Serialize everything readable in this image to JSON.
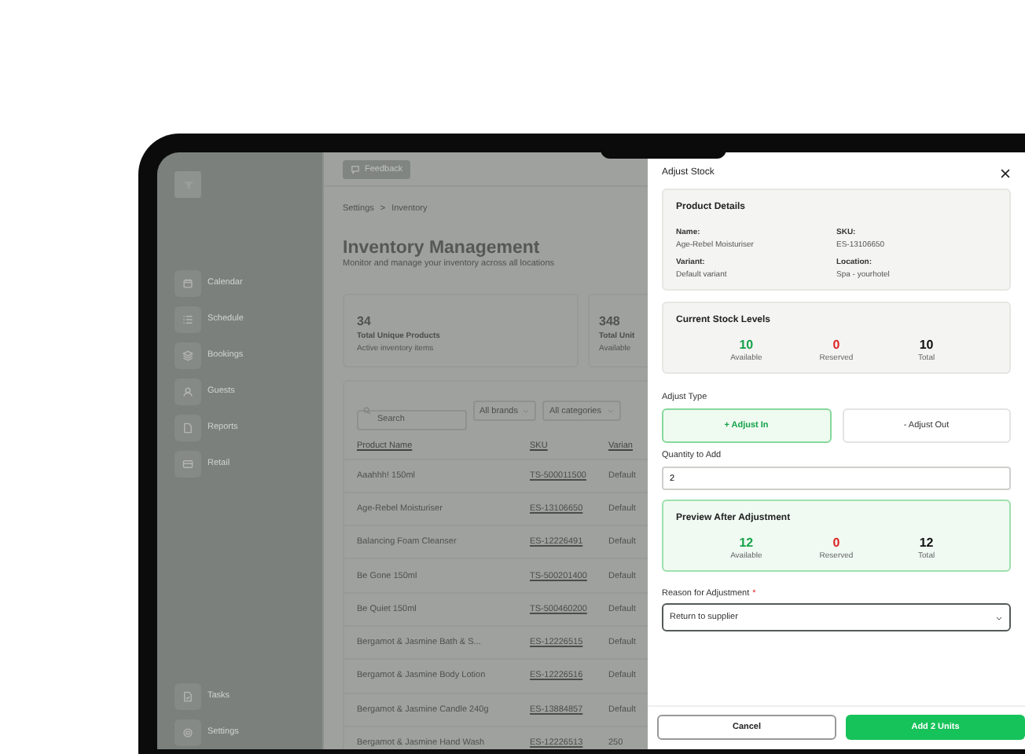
{
  "sidebar": {
    "items": [
      {
        "label": "Calendar"
      },
      {
        "label": "Schedule"
      },
      {
        "label": "Bookings"
      },
      {
        "label": "Guests"
      },
      {
        "label": "Reports"
      },
      {
        "label": "Retail"
      }
    ],
    "bottom_items": [
      {
        "label": "Tasks"
      },
      {
        "label": "Settings"
      }
    ]
  },
  "main": {
    "feedback_button": "Feedback",
    "breadcrumb": [
      "Settings",
      ">",
      "Inventory"
    ],
    "title": "Inventory Management",
    "subtitle": "Monitor and manage your inventory across all locations",
    "stats": [
      {
        "value": "34",
        "label": "Total Unique Products",
        "caption": "Active inventory items"
      },
      {
        "value": "348",
        "label": "Total Unit",
        "caption": "Available"
      }
    ],
    "search": {
      "placeholder": "Search"
    },
    "filters": [
      "All brands",
      "All categories"
    ],
    "table": {
      "columns": [
        "Product Name",
        "SKU",
        "Varian"
      ],
      "rows": [
        [
          "Aaahhh! 150ml",
          "TS-500011500",
          "Default"
        ],
        [
          "Age-Rebel Moisturiser",
          "ES-13106650",
          "Default"
        ],
        [
          "Balancing Foam Cleanser",
          "ES-12226491",
          "Default"
        ],
        [
          "Be Gone 150ml",
          "TS-500201400",
          "Default"
        ],
        [
          "Be Quiet 150ml",
          "TS-500460200",
          "Default"
        ],
        [
          "Bergamot & Jasmine Bath & S...",
          "ES-12226515",
          "Default"
        ],
        [
          "Bergamot & Jasmine Body Lotion",
          "ES-12226516",
          "Default"
        ],
        [
          "Bergamot & Jasmine Candle 240g",
          "ES-13884857",
          "Default"
        ],
        [
          "Bergamot & Jasmine Hand Wash",
          "ES-12226513",
          "250"
        ]
      ]
    }
  },
  "panel": {
    "title": "Adjust Stock",
    "product_details": {
      "title": "Product Details",
      "fields": [
        {
          "label": "Name:",
          "value": "Age-Rebel Moisturiser"
        },
        {
          "label": "SKU:",
          "value": "ES-13106650"
        },
        {
          "label": "Variant:",
          "value": "Default variant"
        },
        {
          "label": "Location:",
          "value": "Spa - yourhotel"
        }
      ]
    },
    "current_stock": {
      "title": "Current Stock Levels",
      "stats": [
        {
          "value": "10",
          "label": "Available",
          "kind": "available"
        },
        {
          "value": "0",
          "label": "Reserved",
          "kind": "reserved"
        },
        {
          "value": "10",
          "label": "Total",
          "kind": "total"
        }
      ]
    },
    "adjust_type": {
      "label": "Adjust Type",
      "options": [
        {
          "label": "+ Adjust In",
          "selected": true
        },
        {
          "label": "- Adjust Out",
          "selected": false
        }
      ]
    },
    "quantity": {
      "label": "Quantity to Add",
      "value": "2"
    },
    "preview": {
      "title": "Preview After Adjustment",
      "stats": [
        {
          "value": "12",
          "label": "Available",
          "kind": "available"
        },
        {
          "value": "0",
          "label": "Reserved",
          "kind": "reserved"
        },
        {
          "value": "12",
          "label": "Total",
          "kind": "total"
        }
      ]
    },
    "reason": {
      "label": "Reason for Adjustment",
      "required_mark": "*",
      "value": "Return to supplier"
    },
    "buttons": {
      "cancel": "Cancel",
      "confirm": "Add 2 Units"
    }
  }
}
